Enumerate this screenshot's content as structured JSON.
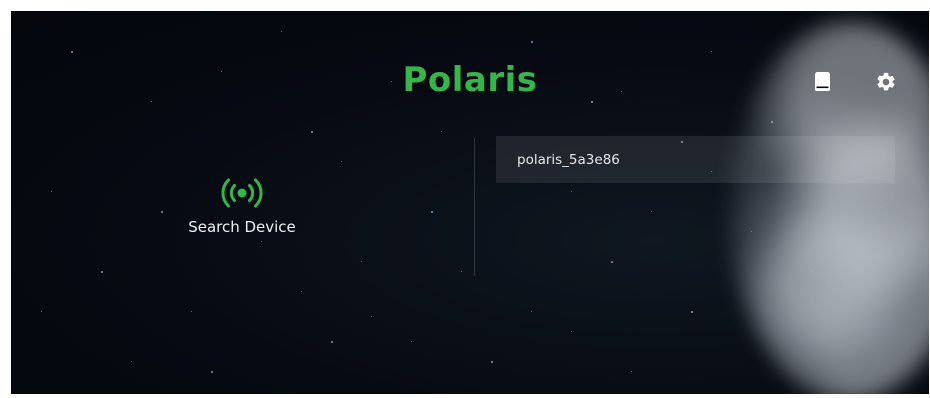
{
  "app": {
    "title": "Polaris"
  },
  "header": {
    "icons": [
      {
        "name": "book-icon",
        "role": "manual"
      },
      {
        "name": "gear-icon",
        "role": "settings"
      }
    ]
  },
  "search": {
    "label": "Search Device",
    "icon": "broadcast-icon"
  },
  "devices": [
    {
      "name": "polaris_5a3e86"
    }
  ],
  "colors": {
    "accent": "#35b54a",
    "background": "#070a12",
    "text": "#eef1f4",
    "item_bg": "rgba(255,255,255,0.09)"
  }
}
